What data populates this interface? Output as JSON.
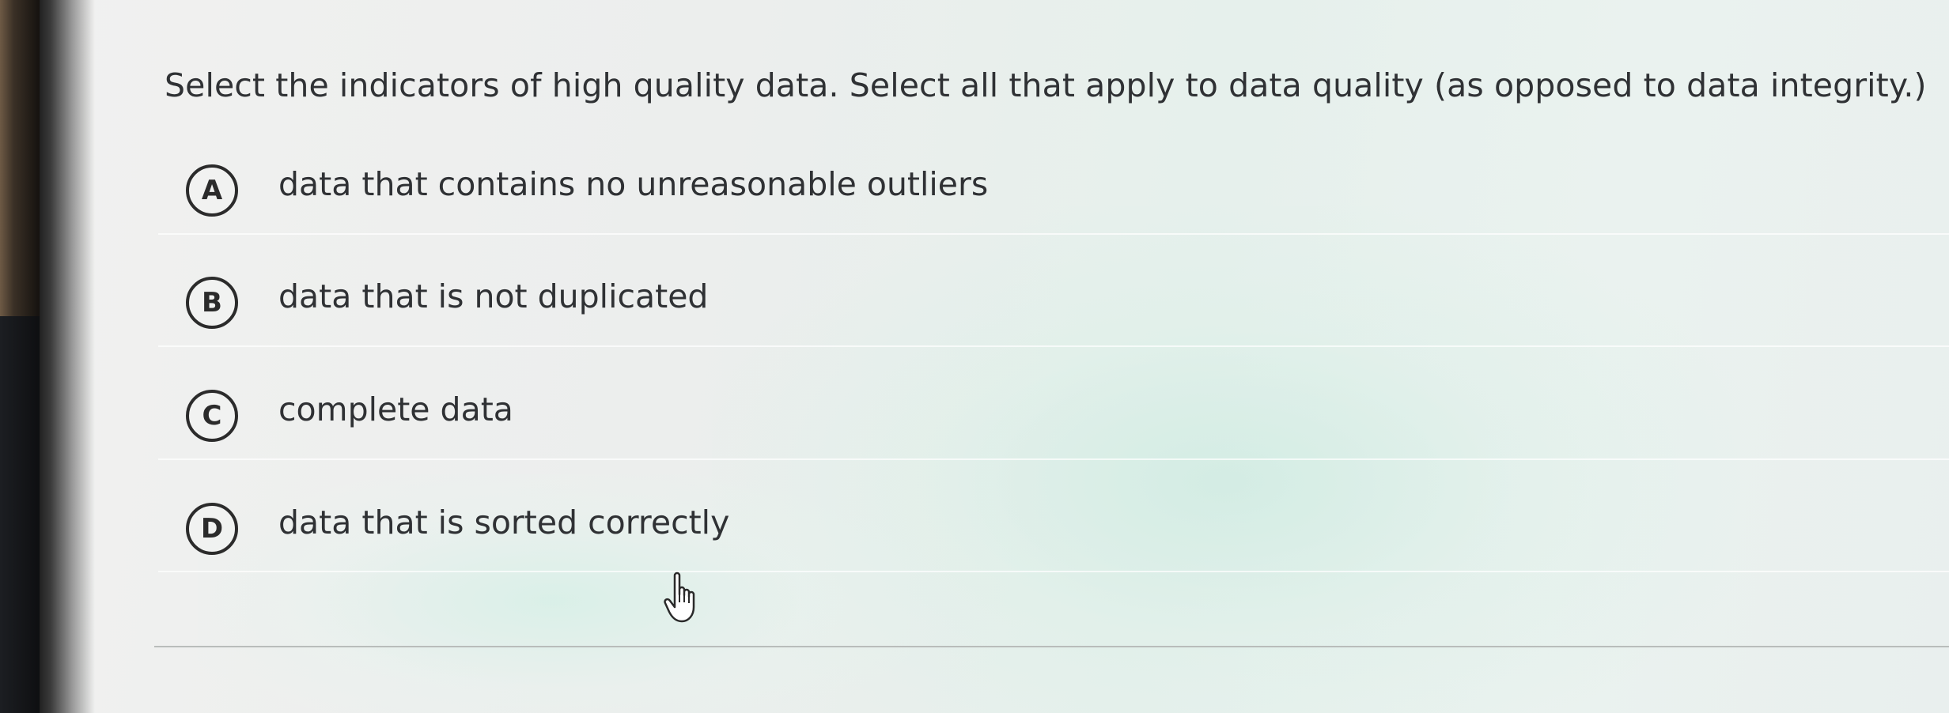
{
  "question": {
    "text": "Select the indicators of high quality data. Select all that apply to data quality (as opposed to data integrity.)"
  },
  "options": [
    {
      "letter": "A",
      "text": "data that contains no unreasonable outliers"
    },
    {
      "letter": "B",
      "text": "data that is not duplicated"
    },
    {
      "letter": "C",
      "text": "complete data"
    },
    {
      "letter": "D",
      "text": "data that is sorted correctly"
    }
  ],
  "cursor": {
    "icon": "hand-pointer-icon"
  },
  "colors": {
    "text": "#2f3134",
    "badge_border": "#2b2b2b",
    "background": "#eceeed"
  }
}
